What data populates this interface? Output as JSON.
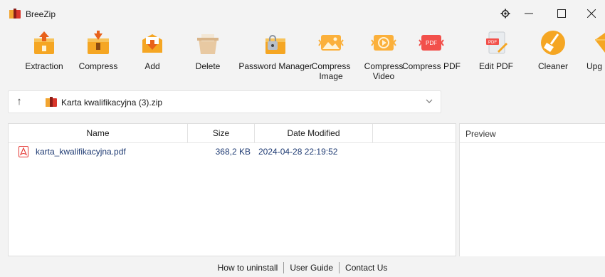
{
  "window": {
    "title": "BreeZip",
    "controls": {
      "settings": "⚙",
      "minimize": "—",
      "maximize": "☐",
      "close": "✕"
    }
  },
  "toolbar": {
    "items": [
      {
        "label": "Extraction",
        "icon": "extraction-icon"
      },
      {
        "label": "Compress",
        "icon": "compress-icon"
      },
      {
        "label": "Add",
        "icon": "add-icon"
      },
      {
        "label": "Delete",
        "icon": "delete-icon"
      },
      {
        "label": "Password Manager",
        "icon": "password-manager-icon"
      },
      {
        "label": "Compress\nImage",
        "line1": "Compress",
        "line2": "Image",
        "icon": "compress-image-icon"
      },
      {
        "label": "Compress\nVideo",
        "line1": "Compress",
        "line2": "Video",
        "icon": "compress-video-icon"
      },
      {
        "label": "Compress PDF",
        "icon": "compress-pdf-icon",
        "badge": "PDF"
      },
      {
        "label": "Edit PDF",
        "icon": "edit-pdf-icon",
        "badge": "PDF"
      },
      {
        "label": "Cleaner",
        "icon": "cleaner-icon"
      },
      {
        "label": "Upg",
        "icon": "upgrade-icon"
      }
    ]
  },
  "pathbar": {
    "path": "Karta kwalifikacyjna (3).zip"
  },
  "filelist": {
    "columns": [
      "Name",
      "Size",
      "Date Modified"
    ],
    "rows": [
      {
        "name": "karta_kwalifikacyjna.pdf",
        "size": "368,2 KB",
        "date": "2024-04-28 22:19:52"
      }
    ]
  },
  "preview": {
    "title": "Preview"
  },
  "footer": {
    "links": [
      "How to uninstall",
      "User Guide",
      "Contact Us"
    ]
  },
  "colors": {
    "accent_orange": "#f5a623",
    "pdf_red": "#e53935",
    "file_text": "#1f3b73"
  }
}
